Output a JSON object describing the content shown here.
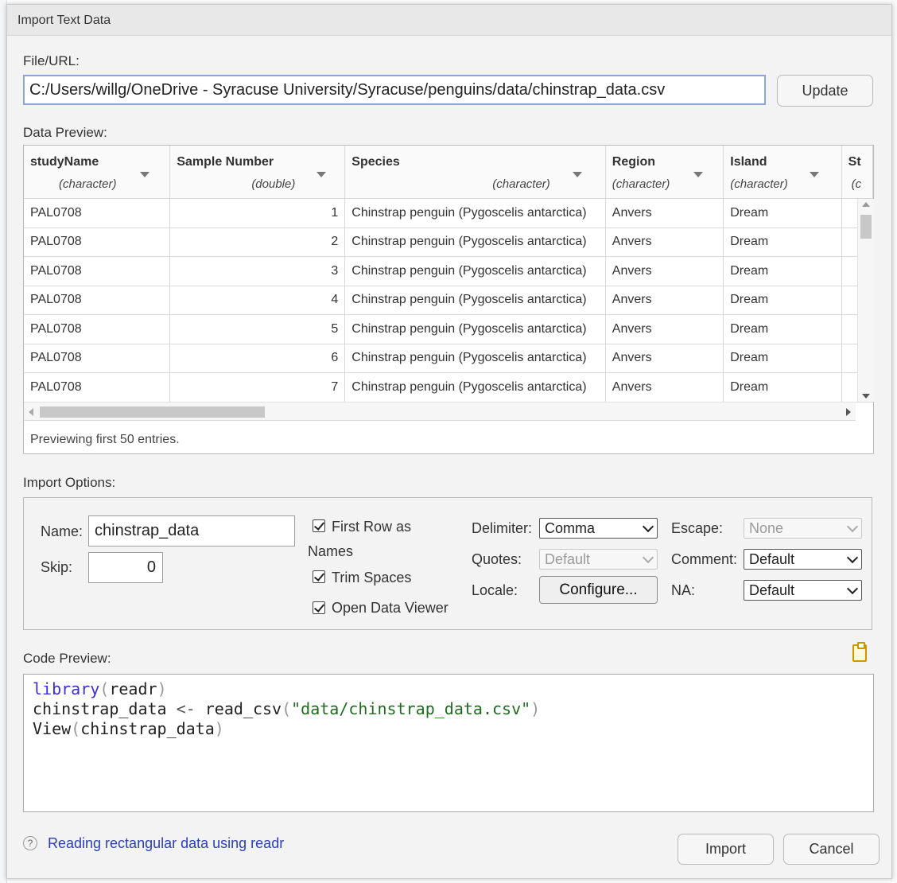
{
  "dialog": {
    "title": "Import Text Data"
  },
  "file": {
    "label": "File/URL:",
    "value": "C:/Users/willg/OneDrive - Syracuse University/Syracuse/penguins/data/chinstrap_data.csv",
    "update_label": "Update"
  },
  "preview": {
    "label": "Data Preview:",
    "columns": [
      {
        "name": "studyName",
        "type": "(character)"
      },
      {
        "name": "Sample Number",
        "type": "(double)"
      },
      {
        "name": "Species",
        "type": "(character)"
      },
      {
        "name": "Region",
        "type": "(character)"
      },
      {
        "name": "Island",
        "type": "(character)"
      },
      {
        "name": "St",
        "type": "(c"
      }
    ],
    "rows": [
      [
        "PAL0708",
        "1",
        "Chinstrap penguin (Pygoscelis antarctica)",
        "Anvers",
        "Dream"
      ],
      [
        "PAL0708",
        "2",
        "Chinstrap penguin (Pygoscelis antarctica)",
        "Anvers",
        "Dream"
      ],
      [
        "PAL0708",
        "3",
        "Chinstrap penguin (Pygoscelis antarctica)",
        "Anvers",
        "Dream"
      ],
      [
        "PAL0708",
        "4",
        "Chinstrap penguin (Pygoscelis antarctica)",
        "Anvers",
        "Dream"
      ],
      [
        "PAL0708",
        "5",
        "Chinstrap penguin (Pygoscelis antarctica)",
        "Anvers",
        "Dream"
      ],
      [
        "PAL0708",
        "6",
        "Chinstrap penguin (Pygoscelis antarctica)",
        "Anvers",
        "Dream"
      ],
      [
        "PAL0708",
        "7",
        "Chinstrap penguin (Pygoscelis antarctica)",
        "Anvers",
        "Dream"
      ]
    ],
    "note": "Previewing first 50 entries."
  },
  "options": {
    "label": "Import Options:",
    "name_label": "Name:",
    "name_value": "chinstrap_data",
    "skip_label": "Skip:",
    "skip_value": "0",
    "first_row_line1": "First Row as",
    "first_row_line2": "Names",
    "trim_spaces": "Trim Spaces",
    "open_viewer": "Open Data Viewer",
    "delimiter_label": "Delimiter:",
    "delimiter_value": "Comma",
    "quotes_label": "Quotes:",
    "quotes_value": "Default",
    "locale_label": "Locale:",
    "configure_label": "Configure...",
    "escape_label": "Escape:",
    "escape_value": "None",
    "comment_label": "Comment:",
    "comment_value": "Default",
    "na_label": "NA:",
    "na_value": "Default"
  },
  "code": {
    "label": "Code Preview:",
    "line1_fn": "library",
    "line1_arg": "readr",
    "line2_var": "chinstrap_data",
    "line2_op": "<-",
    "line2_fn": "read_csv",
    "line2_str": "\"data/chinstrap_data.csv\"",
    "line3_fn": "View",
    "line3_arg": "chinstrap_data",
    "paren_open": "(",
    "paren_close": ")"
  },
  "footer": {
    "help_icon": "?",
    "help_link": "Reading rectangular data using readr",
    "import_label": "Import",
    "cancel_label": "Cancel"
  },
  "colors": {
    "accent_border": "#8aa7d6",
    "link": "#2b3fb5",
    "keyword": "#3a2fd4",
    "string": "#1f6b1f"
  }
}
